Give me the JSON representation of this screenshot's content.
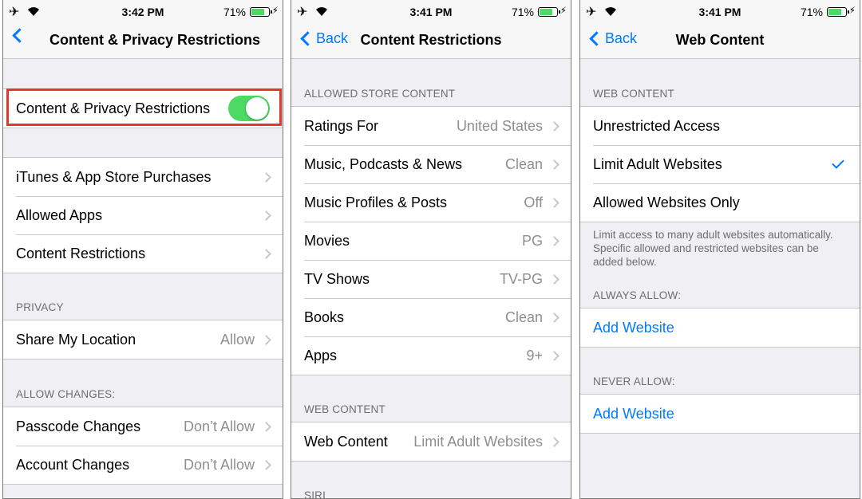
{
  "screens": [
    {
      "status": {
        "time": "3:42 PM",
        "battery": "71%"
      },
      "nav": {
        "back_label": "",
        "title": "Content & Privacy Restrictions"
      },
      "toggle_row": {
        "label": "Content & Privacy Restrictions",
        "on": true
      },
      "group_main": [
        {
          "label": "iTunes & App Store Purchases"
        },
        {
          "label": "Allowed Apps"
        },
        {
          "label": "Content Restrictions"
        }
      ],
      "privacy": {
        "header": "PRIVACY",
        "rows": [
          {
            "label": "Share My Location",
            "value": "Allow"
          }
        ]
      },
      "allow_changes": {
        "header": "ALLOW CHANGES:",
        "rows": [
          {
            "label": "Passcode Changes",
            "value": "Don’t Allow"
          },
          {
            "label": "Account Changes",
            "value": "Don’t Allow"
          }
        ]
      }
    },
    {
      "status": {
        "time": "3:41 PM",
        "battery": "71%"
      },
      "nav": {
        "back_label": "Back",
        "title": "Content Restrictions"
      },
      "store": {
        "header": "ALLOWED STORE CONTENT",
        "rows": [
          {
            "label": "Ratings For",
            "value": "United States"
          },
          {
            "label": "Music, Podcasts & News",
            "value": "Clean"
          },
          {
            "label": "Music Profiles & Posts",
            "value": "Off"
          },
          {
            "label": "Movies",
            "value": "PG"
          },
          {
            "label": "TV Shows",
            "value": "TV-PG"
          },
          {
            "label": "Books",
            "value": "Clean"
          },
          {
            "label": "Apps",
            "value": "9+"
          }
        ]
      },
      "web": {
        "header": "WEB CONTENT",
        "rows": [
          {
            "label": "Web Content",
            "value": "Limit Adult Websites"
          }
        ]
      },
      "cut_header": "SIRI"
    },
    {
      "status": {
        "time": "3:41 PM",
        "battery": "71%"
      },
      "nav": {
        "back_label": "Back",
        "title": "Web Content"
      },
      "web": {
        "header": "WEB CONTENT",
        "options": [
          {
            "label": "Unrestricted Access",
            "selected": false
          },
          {
            "label": "Limit Adult Websites",
            "selected": true
          },
          {
            "label": "Allowed Websites Only",
            "selected": false
          }
        ],
        "footer": "Limit access to many adult websites automatically. Specific allowed and restricted websites can be added below."
      },
      "always_allow": {
        "header": "ALWAYS ALLOW:",
        "add_label": "Add Website"
      },
      "never_allow": {
        "header": "NEVER ALLOW:",
        "add_label": "Add Website"
      }
    }
  ],
  "colors": {
    "accent": "#007aff",
    "toggle_on": "#4cd964",
    "highlight": "#e0382b",
    "background": "#efeff4"
  }
}
